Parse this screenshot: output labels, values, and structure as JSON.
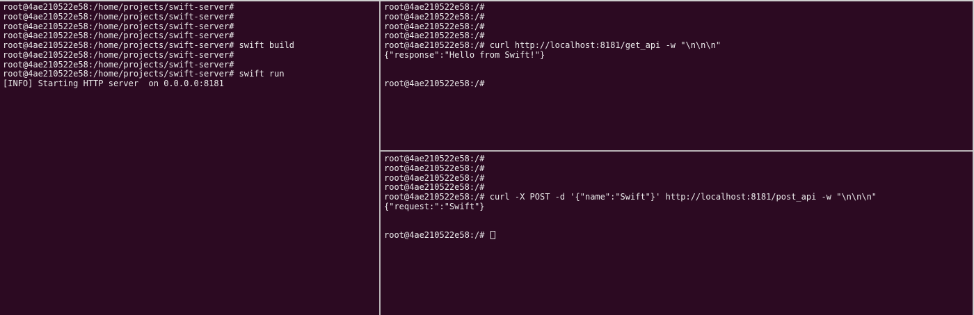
{
  "panes": {
    "left": {
      "lines": [
        "root@4ae210522e58:/home/projects/swift-server#",
        "root@4ae210522e58:/home/projects/swift-server#",
        "root@4ae210522e58:/home/projects/swift-server#",
        "root@4ae210522e58:/home/projects/swift-server#",
        "root@4ae210522e58:/home/projects/swift-server# swift build",
        "root@4ae210522e58:/home/projects/swift-server#",
        "root@4ae210522e58:/home/projects/swift-server#",
        "root@4ae210522e58:/home/projects/swift-server# swift run",
        "[INFO] Starting HTTP server  on 0.0.0.0:8181"
      ]
    },
    "top_right": {
      "lines": [
        "root@4ae210522e58:/#",
        "root@4ae210522e58:/#",
        "root@4ae210522e58:/#",
        "root@4ae210522e58:/#",
        "root@4ae210522e58:/# curl http://localhost:8181/get_api -w \"\\n\\n\\n\"",
        "{\"response\":\"Hello from Swift!\"}",
        "",
        "",
        "root@4ae210522e58:/#"
      ]
    },
    "bottom_right": {
      "lines": [
        "root@4ae210522e58:/#",
        "root@4ae210522e58:/#",
        "root@4ae210522e58:/#",
        "root@4ae210522e58:/#",
        "root@4ae210522e58:/# curl -X POST -d '{\"name\":\"Swift\"}' http://localhost:8181/post_api -w \"\\n\\n\\n\"",
        "{\"request:\":\"Swift\"}",
        "",
        ""
      ],
      "active_prompt": "root@4ae210522e58:/#"
    }
  },
  "colors": {
    "background": "#2c0a22",
    "text": "#ececec",
    "divider": "#b9b4b7"
  },
  "icons": {
    "cursor": "block-cursor-icon"
  }
}
